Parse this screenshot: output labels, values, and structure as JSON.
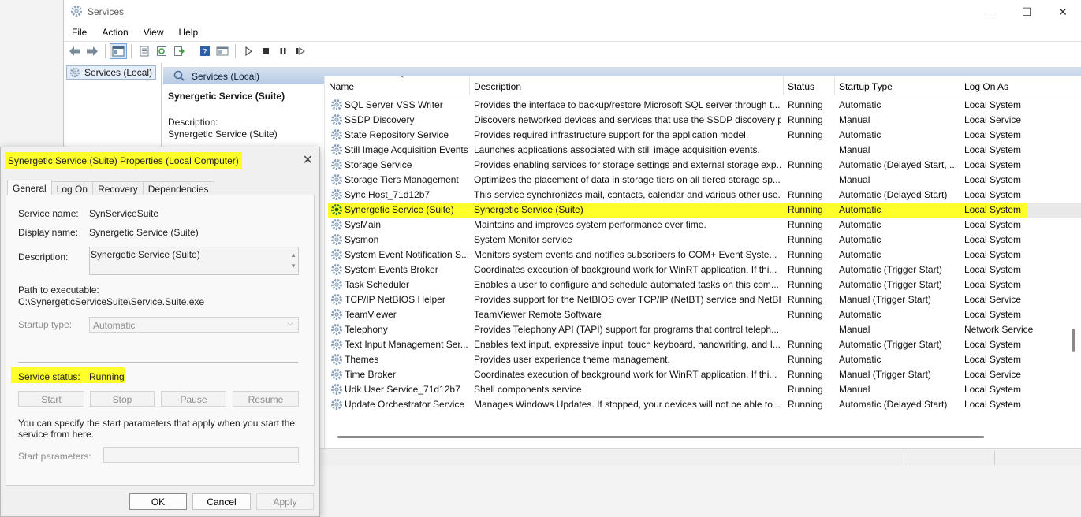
{
  "window": {
    "title": "Services",
    "controls": {
      "minimize": "—",
      "maximize": "☐",
      "close": "✕"
    }
  },
  "menu": [
    "File",
    "Action",
    "View",
    "Help"
  ],
  "tree": {
    "root": "Services (Local)"
  },
  "header": {
    "label": "Services (Local)"
  },
  "extended": {
    "title": "Synergetic Service (Suite)",
    "description_label": "Description:",
    "description": "Synergetic Service (Suite)"
  },
  "columns": {
    "name": "Name",
    "description": "Description",
    "status": "Status",
    "startup": "Startup Type",
    "logon": "Log On As"
  },
  "services": [
    {
      "name": "SQL Server VSS Writer",
      "description": "Provides the interface to backup/restore Microsoft SQL server through t...",
      "status": "Running",
      "startup": "Automatic",
      "logon": "Local System"
    },
    {
      "name": "SSDP Discovery",
      "description": "Discovers networked devices and services that use the SSDP discovery p...",
      "status": "Running",
      "startup": "Manual",
      "logon": "Local Service"
    },
    {
      "name": "State Repository Service",
      "description": "Provides required infrastructure support for the application model.",
      "status": "Running",
      "startup": "Automatic",
      "logon": "Local System"
    },
    {
      "name": "Still Image Acquisition Events",
      "description": "Launches applications associated with still image acquisition events.",
      "status": "",
      "startup": "Manual",
      "logon": "Local System"
    },
    {
      "name": "Storage Service",
      "description": "Provides enabling services for storage settings and external storage exp...",
      "status": "Running",
      "startup": "Automatic (Delayed Start, ...",
      "logon": "Local System"
    },
    {
      "name": "Storage Tiers Management",
      "description": "Optimizes the placement of data in storage tiers on all tiered storage sp...",
      "status": "",
      "startup": "Manual",
      "logon": "Local System"
    },
    {
      "name": "Sync Host_71d12b7",
      "description": "This service synchronizes mail, contacts, calendar and various other use...",
      "status": "Running",
      "startup": "Automatic (Delayed Start)",
      "logon": "Local System"
    },
    {
      "name": "Synergetic Service (Suite)",
      "description": "Synergetic Service (Suite)",
      "status": "Running",
      "startup": "Automatic",
      "logon": "Local System",
      "selected": true
    },
    {
      "name": "SysMain",
      "description": "Maintains and improves system performance over time.",
      "status": "Running",
      "startup": "Automatic",
      "logon": "Local System"
    },
    {
      "name": "Sysmon",
      "description": "System Monitor service",
      "status": "Running",
      "startup": "Automatic",
      "logon": "Local System"
    },
    {
      "name": "System Event Notification S...",
      "description": "Monitors system events and notifies subscribers to COM+ Event Syste...",
      "status": "Running",
      "startup": "Automatic",
      "logon": "Local System"
    },
    {
      "name": "System Events Broker",
      "description": "Coordinates execution of background work for WinRT application. If thi...",
      "status": "Running",
      "startup": "Automatic (Trigger Start)",
      "logon": "Local System"
    },
    {
      "name": "Task Scheduler",
      "description": "Enables a user to configure and schedule automated tasks on this com...",
      "status": "Running",
      "startup": "Automatic (Trigger Start)",
      "logon": "Local System"
    },
    {
      "name": "TCP/IP NetBIOS Helper",
      "description": "Provides support for the NetBIOS over TCP/IP (NetBT) service and NetBI...",
      "status": "Running",
      "startup": "Manual (Trigger Start)",
      "logon": "Local Service"
    },
    {
      "name": "TeamViewer",
      "description": "TeamViewer Remote Software",
      "status": "Running",
      "startup": "Automatic",
      "logon": "Local System"
    },
    {
      "name": "Telephony",
      "description": "Provides Telephony API (TAPI) support for programs that control teleph...",
      "status": "",
      "startup": "Manual",
      "logon": "Network Service"
    },
    {
      "name": "Text Input Management Ser...",
      "description": "Enables text input, expressive input, touch keyboard, handwriting, and I...",
      "status": "Running",
      "startup": "Automatic (Trigger Start)",
      "logon": "Local System"
    },
    {
      "name": "Themes",
      "description": "Provides user experience theme management.",
      "status": "Running",
      "startup": "Automatic",
      "logon": "Local System"
    },
    {
      "name": "Time Broker",
      "description": "Coordinates execution of background work for WinRT application. If thi...",
      "status": "Running",
      "startup": "Manual (Trigger Start)",
      "logon": "Local Service"
    },
    {
      "name": "Udk User Service_71d12b7",
      "description": "Shell components service",
      "status": "Running",
      "startup": "Manual",
      "logon": "Local System"
    },
    {
      "name": "Update Orchestrator Service",
      "description": "Manages Windows Updates. If stopped, your devices will not be able to ...",
      "status": "Running",
      "startup": "Automatic (Delayed Start)",
      "logon": "Local System"
    }
  ],
  "dialog": {
    "title": "Synergetic Service (Suite) Properties (Local Computer)",
    "tabs": [
      "General",
      "Log On",
      "Recovery",
      "Dependencies"
    ],
    "service_name_label": "Service name:",
    "service_name": "SynServiceSuite",
    "display_name_label": "Display name:",
    "display_name": "Synergetic Service (Suite)",
    "description_label": "Description:",
    "description": "Synergetic Service (Suite)",
    "path_label": "Path to executable:",
    "path": "C:\\SynergeticServiceSuite\\Service.Suite.exe",
    "startup_type_label": "Startup type:",
    "startup_type": "Automatic",
    "status_label": "Service status:",
    "status": "Running",
    "buttons": {
      "start": "Start",
      "stop": "Stop",
      "pause": "Pause",
      "resume": "Resume"
    },
    "hint": "You can specify the start parameters that apply when you start the service from here.",
    "params_label": "Start parameters:",
    "ok": "OK",
    "cancel": "Cancel",
    "apply": "Apply"
  },
  "colors": {
    "highlight": "#ffff29",
    "header_gradient": "#b9cce3"
  }
}
